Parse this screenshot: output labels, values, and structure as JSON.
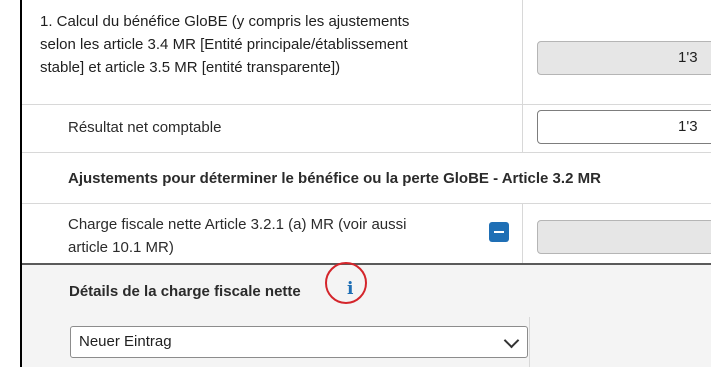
{
  "section": {
    "title_line1": "1. Calcul du bénéfice GloBE (y compris les ajustements",
    "title_line2": "selon les article 3.4 MR [Entité principale/établissement",
    "title_line3": "stable] et article 3.5 MR [entité transparente])",
    "value": "1'3"
  },
  "net_income": {
    "label": "Résultat net comptable",
    "value": "1'3"
  },
  "adjustments": {
    "heading": "Ajustements pour déterminer le bénéfice ou la perte GloBE - Article 3.2 MR"
  },
  "tax_charge": {
    "label_line1": "Charge fiscale nette Article 3.2.1 (a) MR (voir aussi",
    "label_line2": "article 10.1 MR)",
    "value": ""
  },
  "details": {
    "heading": "Détails de la charge fiscale nette",
    "info_glyph": "i"
  },
  "entry_select": {
    "selected": "Neuer Eintrag"
  },
  "colors": {
    "accent": "#1f6fb5",
    "highlight_circle": "#d4252b",
    "readonly_bg": "#e6e6e6"
  }
}
